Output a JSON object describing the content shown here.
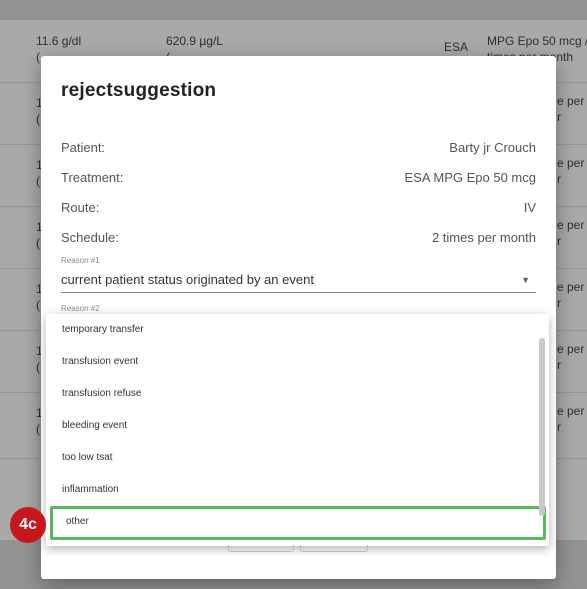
{
  "background": {
    "row1": {
      "hb": "11.6 g/dl",
      "ferritin": "620.9 µg/L",
      "type": "ESA",
      "treatment": "MPG Epo 50 mcg / 2",
      "treatment_line2": "times per month"
    },
    "side_texts": [
      "e per",
      "e per",
      "e per",
      "e per",
      "e per",
      "e per"
    ],
    "lead_char": "1"
  },
  "dialog": {
    "title": "rejectsuggestion",
    "fields": [
      {
        "label": "Patient:",
        "value": "Barty jr Crouch"
      },
      {
        "label": "Treatment:",
        "value": "ESA MPG Epo 50 mcg"
      },
      {
        "label": "Route:",
        "value": "IV"
      },
      {
        "label": "Schedule:",
        "value": "2 times per month"
      }
    ],
    "reason1": {
      "label": "Reason #1",
      "value": "current patient status originated by an event"
    },
    "reason2": {
      "label": "Reason #2"
    }
  },
  "dropdown": {
    "options": [
      "temporary transfer",
      "transfusion event",
      "transfusion refuse",
      "bleeding event",
      "too low tsat",
      "inflammation",
      "other"
    ],
    "selected_index": 6
  },
  "annotation": {
    "badge": "4c"
  },
  "colors": {
    "highlight": "#5cb85c",
    "badge": "#c8161d"
  }
}
